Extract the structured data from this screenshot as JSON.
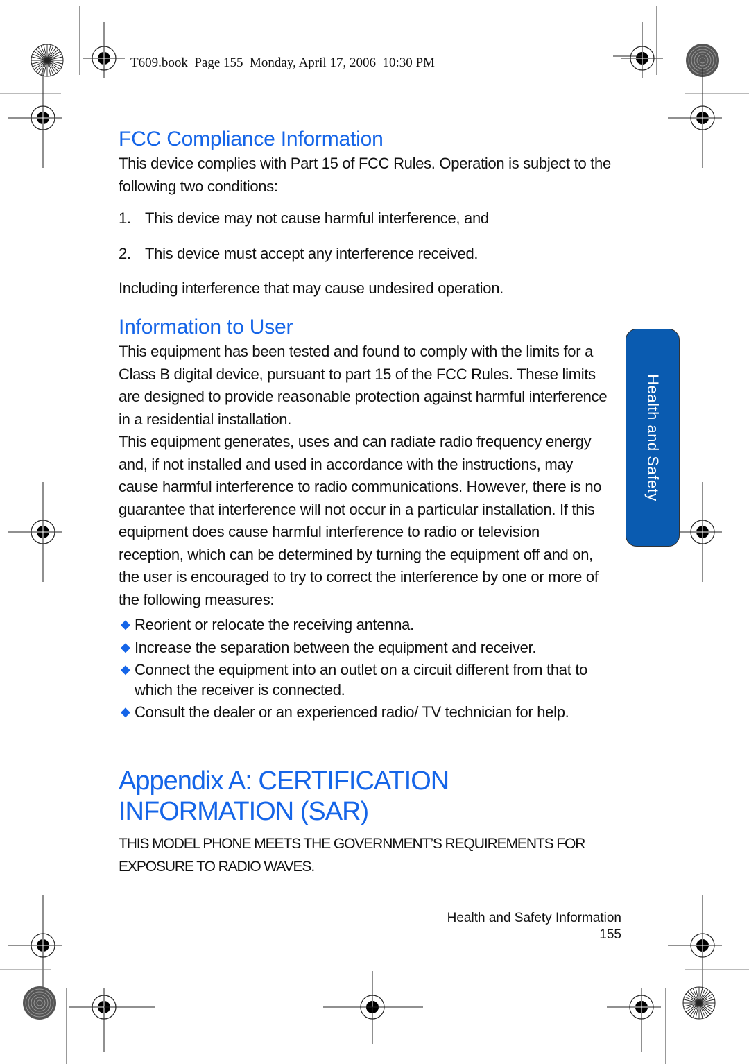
{
  "header": {
    "print_line": "T609.book  Page 155  Monday, April 17, 2006  10:30 PM"
  },
  "colors": {
    "accent_blue": "#1565e8",
    "tab_blue": "#0a5bb0"
  },
  "sections": {
    "fcc": {
      "title": "FCC Compliance Information",
      "intro": "This device complies with Part 15 of FCC Rules. Operation is subject to the following two conditions:",
      "conditions": [
        {
          "num": "1.",
          "text": "This device may not cause harmful interference, and"
        },
        {
          "num": "2.",
          "text": "This device must accept any interference received."
        }
      ],
      "closing": "Including interference that may cause undesired operation."
    },
    "info_to_user": {
      "title": "Information to User",
      "para1": "This equipment has been tested and found to comply with the limits for a Class B digital device, pursuant to part 15 of the FCC Rules. These limits are designed to provide reasonable protection against harmful interference in a residential installation.",
      "para2": "This equipment generates, uses and can radiate radio frequency energy and, if not installed and used in accordance with the instructions, may cause harmful interference to radio communications. However, there is no guarantee that interference will not occur in a particular installation. If this equipment does cause harmful interference to radio or television reception, which can be determined by turning the equipment off and on, the user is encouraged to try to correct the interference by one or more of the following measures:",
      "bullet_icon": "diamond-bullet-icon",
      "measures": [
        "Reorient or relocate the receiving antenna.",
        "Increase the separation between the equipment and receiver.",
        "Connect the equipment into an outlet on a circuit different from that to which the receiver is connected.",
        "Consult the dealer or an experienced radio/ TV technician for help."
      ]
    },
    "appendix": {
      "title": "Appendix A: CERTIFICATION INFORMATION (SAR)",
      "statement": "THIS MODEL PHONE MEETS THE GOVERNMENT’S REQUIREMENTS FOR EXPOSURE TO RADIO WAVES."
    }
  },
  "side_tab": {
    "label": "Health and Safety"
  },
  "footer": {
    "section_title": "Health and Safety Information",
    "page_number": "155"
  }
}
